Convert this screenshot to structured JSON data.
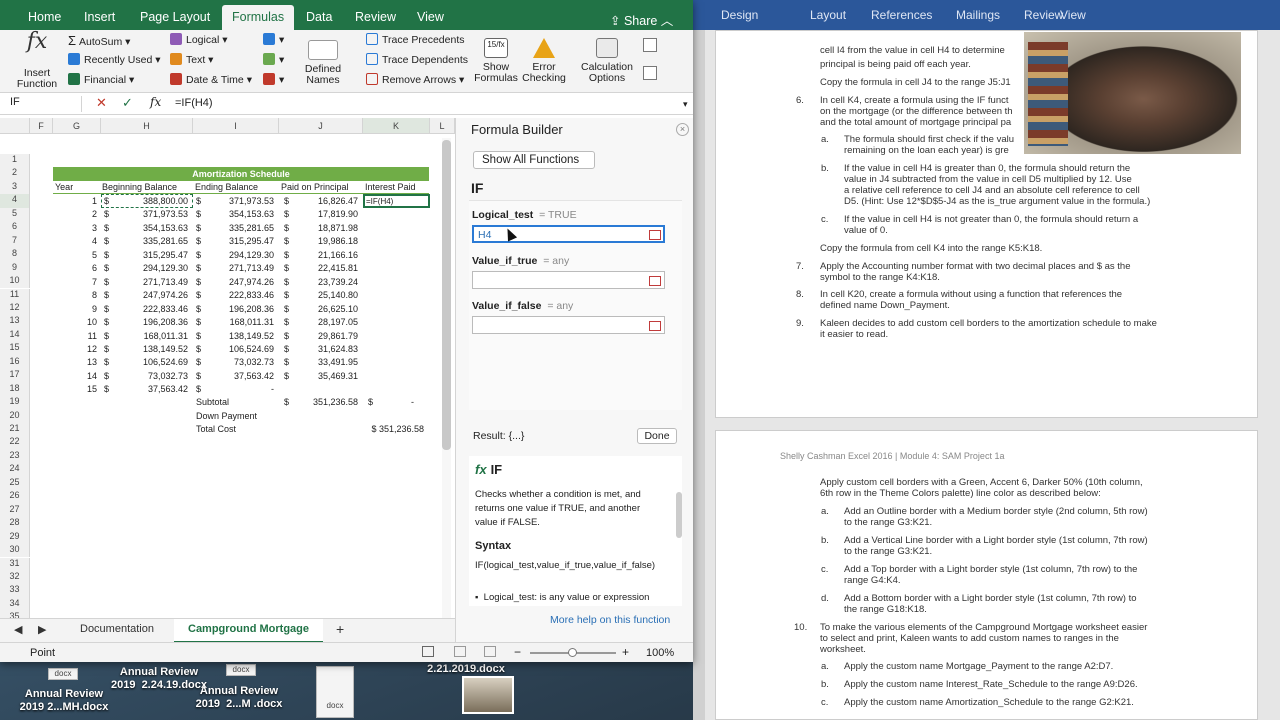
{
  "excel": {
    "tabs": [
      "Home",
      "Insert",
      "Page Layout",
      "Formulas",
      "Data",
      "Review",
      "View"
    ],
    "active_tab": "Formulas",
    "share": "Share",
    "ribbon": {
      "insert_function": "Insert\nFunction",
      "autosum": "AutoSum",
      "recently_used": "Recently Used",
      "financial": "Financial",
      "logical": "Logical",
      "text": "Text",
      "date_time": "Date & Time",
      "defined_names": "Defined\nNames",
      "trace_precedents": "Trace Precedents",
      "trace_dependents": "Trace Dependents",
      "remove_arrows": "Remove Arrows",
      "show_formulas": "Show\nFormulas",
      "error_checking": "Error\nChecking",
      "calculation_options": "Calculation\nOptions"
    },
    "formula_bar": {
      "name_box": "IF",
      "formula": "=IF(H4)",
      "cancel": "✕",
      "enter": "✓",
      "fx": "fx"
    },
    "columns": [
      "F",
      "G",
      "H",
      "I",
      "J",
      "K",
      "L"
    ],
    "rows": [
      "1",
      "2",
      "3",
      "4",
      "5",
      "6",
      "7",
      "8",
      "9",
      "10",
      "11",
      "12",
      "13",
      "14",
      "15",
      "16",
      "17",
      "18",
      "19",
      "20",
      "21",
      "22",
      "23",
      "24",
      "25",
      "26",
      "27",
      "28",
      "29",
      "30",
      "31",
      "32",
      "33",
      "34",
      "35"
    ],
    "sheet": {
      "banner": "Amortization Schedule",
      "headers": [
        "Year",
        "Beginning Balance",
        "Ending Balance",
        "Paid on Principal",
        "Interest Paid"
      ],
      "data": [
        [
          "1",
          "$",
          "388,800.00",
          "$",
          "371,973.53",
          "$",
          "16,826.47",
          "=IF(H4)"
        ],
        [
          "2",
          "$",
          "371,973.53",
          "$",
          "354,153.63",
          "$",
          "17,819.90",
          ""
        ],
        [
          "3",
          "$",
          "354,153.63",
          "$",
          "335,281.65",
          "$",
          "18,871.98",
          ""
        ],
        [
          "4",
          "$",
          "335,281.65",
          "$",
          "315,295.47",
          "$",
          "19,986.18",
          ""
        ],
        [
          "5",
          "$",
          "315,295.47",
          "$",
          "294,129.30",
          "$",
          "21,166.16",
          ""
        ],
        [
          "6",
          "$",
          "294,129.30",
          "$",
          "271,713.49",
          "$",
          "22,415.81",
          ""
        ],
        [
          "7",
          "$",
          "271,713.49",
          "$",
          "247,974.26",
          "$",
          "23,739.24",
          ""
        ],
        [
          "8",
          "$",
          "247,974.26",
          "$",
          "222,833.46",
          "$",
          "25,140.80",
          ""
        ],
        [
          "9",
          "$",
          "222,833.46",
          "$",
          "196,208.36",
          "$",
          "26,625.10",
          ""
        ],
        [
          "10",
          "$",
          "196,208.36",
          "$",
          "168,011.31",
          "$",
          "28,197.05",
          ""
        ],
        [
          "11",
          "$",
          "168,011.31",
          "$",
          "138,149.52",
          "$",
          "29,861.79",
          ""
        ],
        [
          "12",
          "$",
          "138,149.52",
          "$",
          "106,524.69",
          "$",
          "31,624.83",
          ""
        ],
        [
          "13",
          "$",
          "106,524.69",
          "$",
          "73,032.73",
          "$",
          "33,491.95",
          ""
        ],
        [
          "14",
          "$",
          "73,032.73",
          "$",
          "37,563.42",
          "$",
          "35,469.31",
          ""
        ],
        [
          "15",
          "$",
          "37,563.42",
          "$",
          "-",
          "",
          "",
          " "
        ]
      ],
      "subtotal_label": "Subtotal",
      "subtotal_dollar": "$",
      "subtotal_value": "351,236.58",
      "subtotal_k_dollar": "$",
      "subtotal_k_value": "-",
      "down_payment_label": "Down Payment",
      "total_cost_label": "Total Cost",
      "total_cost_value": "$ 351,236.58"
    },
    "sheet_tabs": [
      "Documentation",
      "Campground Mortgage"
    ],
    "active_sheet": "Campground Mortgage",
    "add_sheet": "+",
    "status": {
      "mode": "Point",
      "zoom": "100%",
      "minus": "−",
      "plus": "+"
    }
  },
  "formula_builder": {
    "title": "Formula Builder",
    "close": "×",
    "show_all": "Show All Functions",
    "function_name": "IF",
    "args": [
      {
        "name": "Logical_test",
        "eq": "=",
        "value": "TRUE",
        "input": "H4"
      },
      {
        "name": "Value_if_true",
        "eq": "=",
        "value": "any",
        "input": ""
      },
      {
        "name": "Value_if_false",
        "eq": "=",
        "value": "any",
        "input": ""
      }
    ],
    "result": "Result: {...}",
    "done": "Done",
    "help_fx": "fx",
    "help_title": "IF",
    "description": "Checks whether a condition is met, and returns one value if TRUE, and another value if FALSE.",
    "syntax_label": "Syntax",
    "syntax": "IF(logical_test,value_if_true,value_if_false)",
    "bullet": "Logical_test: is any value or expression",
    "more_help": "More help on this function"
  },
  "word": {
    "tabs": [
      "Design",
      "Layout",
      "References",
      "Mailings",
      "Review",
      "View"
    ],
    "page1_lines": [
      "cell I4 from the value in cell H4 to determine",
      "principal is being paid off each year.",
      "Copy the formula in cell J4 to the range J5:J1"
    ],
    "item6_num": "6.",
    "item6_lines": [
      "In cell K4, create a formula using the IF funct",
      "on the mortgage (or the difference between th",
      "and the total amount of mortgage principal pa"
    ],
    "item6a_letter": "a.",
    "item6a_lines": [
      "The formula should first check if the valu",
      "remaining on the loan each year) is gre"
    ],
    "item6b_letter": "b.",
    "item6b_lines": [
      "If the value in cell H4 is greater than 0, the formula should return the",
      "value in J4 subtracted from the value in cell D5 multiplied by 12. Use",
      "a relative cell reference to cell J4 and an absolute cell reference to cell",
      "D5. (Hint: Use 12*$D$5-J4 as the is_true argument value in the formula.)"
    ],
    "item6c_letter": "c.",
    "item6c_lines": [
      "If the value in cell H4 is not greater than 0, the formula should return a",
      "value of 0."
    ],
    "copy_line": "Copy the formula from cell K4 into the range K5:K18.",
    "item7_num": "7.",
    "item7_lines": [
      "Apply the Accounting number format with two decimal places and $ as the",
      "symbol to the range K4:K18."
    ],
    "item8_num": "8.",
    "item8_lines": [
      "In cell K20, create a formula without using a function that references the",
      "defined name Down_Payment."
    ],
    "item9_num": "9.",
    "item9_lines": [
      "Kaleen decides to add custom cell borders to the amortization schedule to make",
      "it easier to read."
    ],
    "page2_header": "Shelly Cashman Excel 2016 | Module 4: SAM Project 1a",
    "p2_intro": [
      "Apply custom cell borders with a Green, Accent 6, Darker 50% (10th column,",
      "6th row in the Theme Colors palette) line color as described below:"
    ],
    "p2_a_letter": "a.",
    "p2_a": [
      "Add an Outline border with a Medium border style (2nd column, 5th row)",
      "to the range G3:K21."
    ],
    "p2_b_letter": "b.",
    "p2_b": [
      "Add a Vertical Line border with a Light border style (1st column, 7th row)",
      "to the range G3:K21."
    ],
    "p2_c_letter": "c.",
    "p2_c": [
      "Add a Top border with a Light border style (1st column, 7th row) to the",
      "range G4:K4."
    ],
    "p2_d_letter": "d.",
    "p2_d": [
      "Add a Bottom border with a Light border style (1st column, 7th row) to",
      "the range G18:K18."
    ],
    "item10_num": "10.",
    "item10_lines": [
      "To make the various elements of the Campground Mortgage worksheet easier",
      "to select and print, Kaleen wants to add custom names to ranges in the",
      "worksheet."
    ],
    "p2_10a_letter": "a.",
    "p2_10a": "Apply the custom name Mortgage_Payment to the range A2:D7.",
    "p2_10b_letter": "b.",
    "p2_10b": "Apply the custom name Interest_Rate_Schedule to the range A9:D26.",
    "p2_10c_letter": "c.",
    "p2_10c": "Apply the custom name Amortization_Schedule to the range G2:K21."
  },
  "desktop": {
    "files": [
      {
        "name": "Annual Review\n2019 2...MH.docx"
      },
      {
        "name": "Annual Review\n2019  2.24.19.docx"
      },
      {
        "name": "Annual Review\n2019  2...M .docx"
      },
      {
        "name": "2.21.2019.docx"
      }
    ],
    "icon_labels": [
      "docx",
      "docx",
      "docx"
    ]
  },
  "colors": {
    "excel_green": "#217346",
    "table_green": "#70ad47",
    "word_blue": "#2b579a"
  }
}
